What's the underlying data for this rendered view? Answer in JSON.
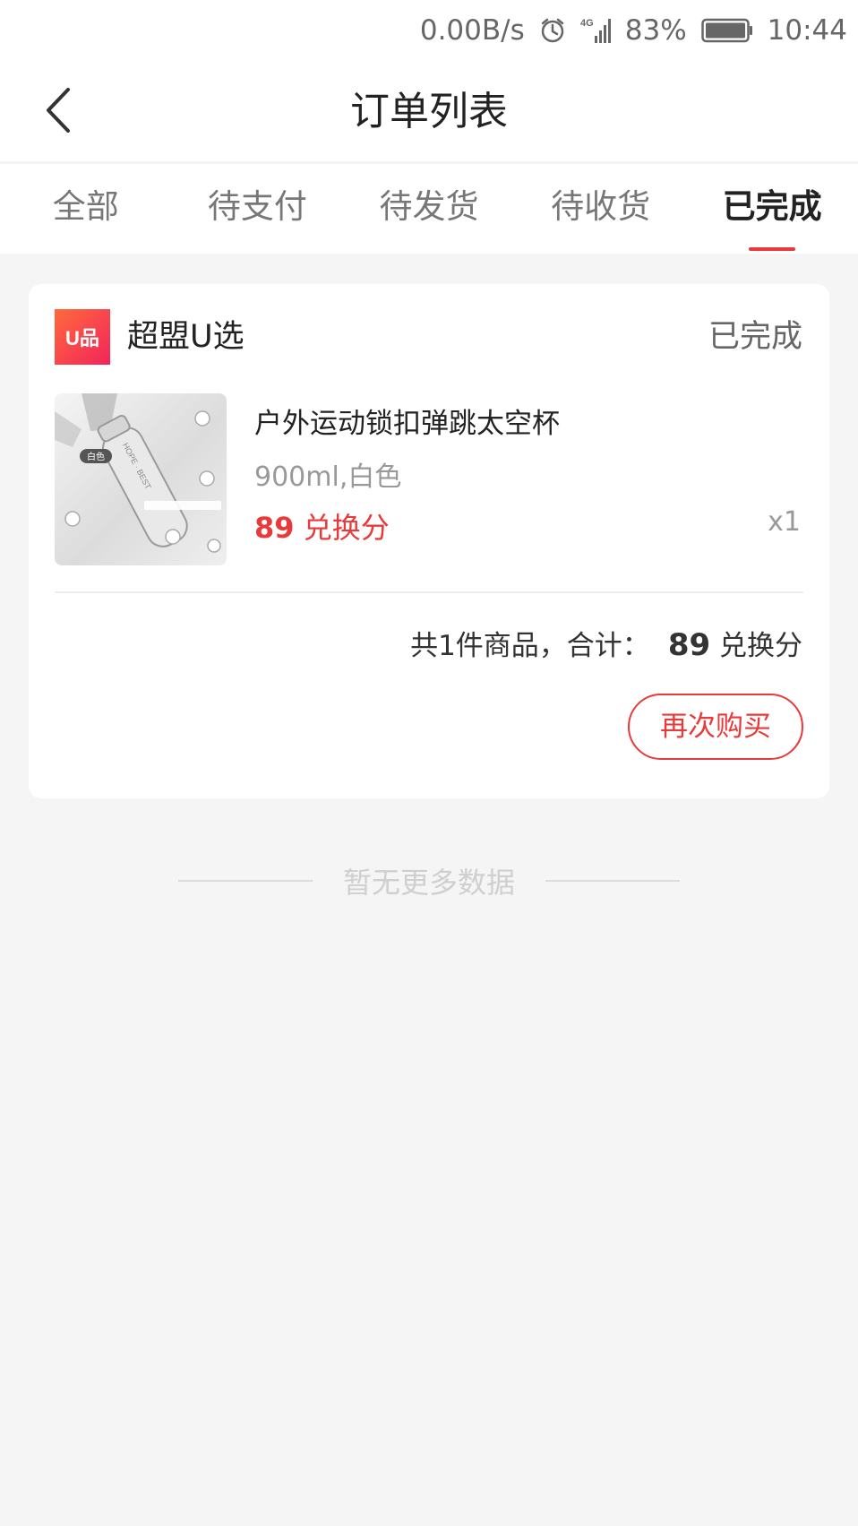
{
  "status_bar": {
    "net_speed": "0.00B/s",
    "alarm_icon": "alarm-clock-icon",
    "signal_label": "4G",
    "battery_percent": "83%",
    "time": "10:44"
  },
  "nav": {
    "back_icon": "chevron-left-icon",
    "title": "订单列表"
  },
  "tabs": [
    {
      "label": "全部",
      "active": false
    },
    {
      "label": "待支付",
      "active": false
    },
    {
      "label": "待发货",
      "active": false
    },
    {
      "label": "待收货",
      "active": false
    },
    {
      "label": "已完成",
      "active": true
    }
  ],
  "order": {
    "shop_logo_text": "U品",
    "shop_name": "超盟U选",
    "status": "已完成",
    "product": {
      "name": "户外运动锁扣弹跳太空杯",
      "spec": "900ml,白色",
      "price_value": "89",
      "price_unit": "兑换分",
      "quantity": "x1",
      "image_tag": "白色",
      "bottle_text": "HOPE · BEST"
    },
    "summary": {
      "label": "共1件商品，合计：",
      "amount": "89",
      "unit": "兑换分"
    },
    "rebuy_label": "再次购买"
  },
  "footer": {
    "no_more_text": "暂无更多数据"
  },
  "colors": {
    "accent": "#e83a3a",
    "background": "#f5f5f5",
    "logo_gradient_start": "#ff6a3d",
    "logo_gradient_end": "#f2245b"
  }
}
